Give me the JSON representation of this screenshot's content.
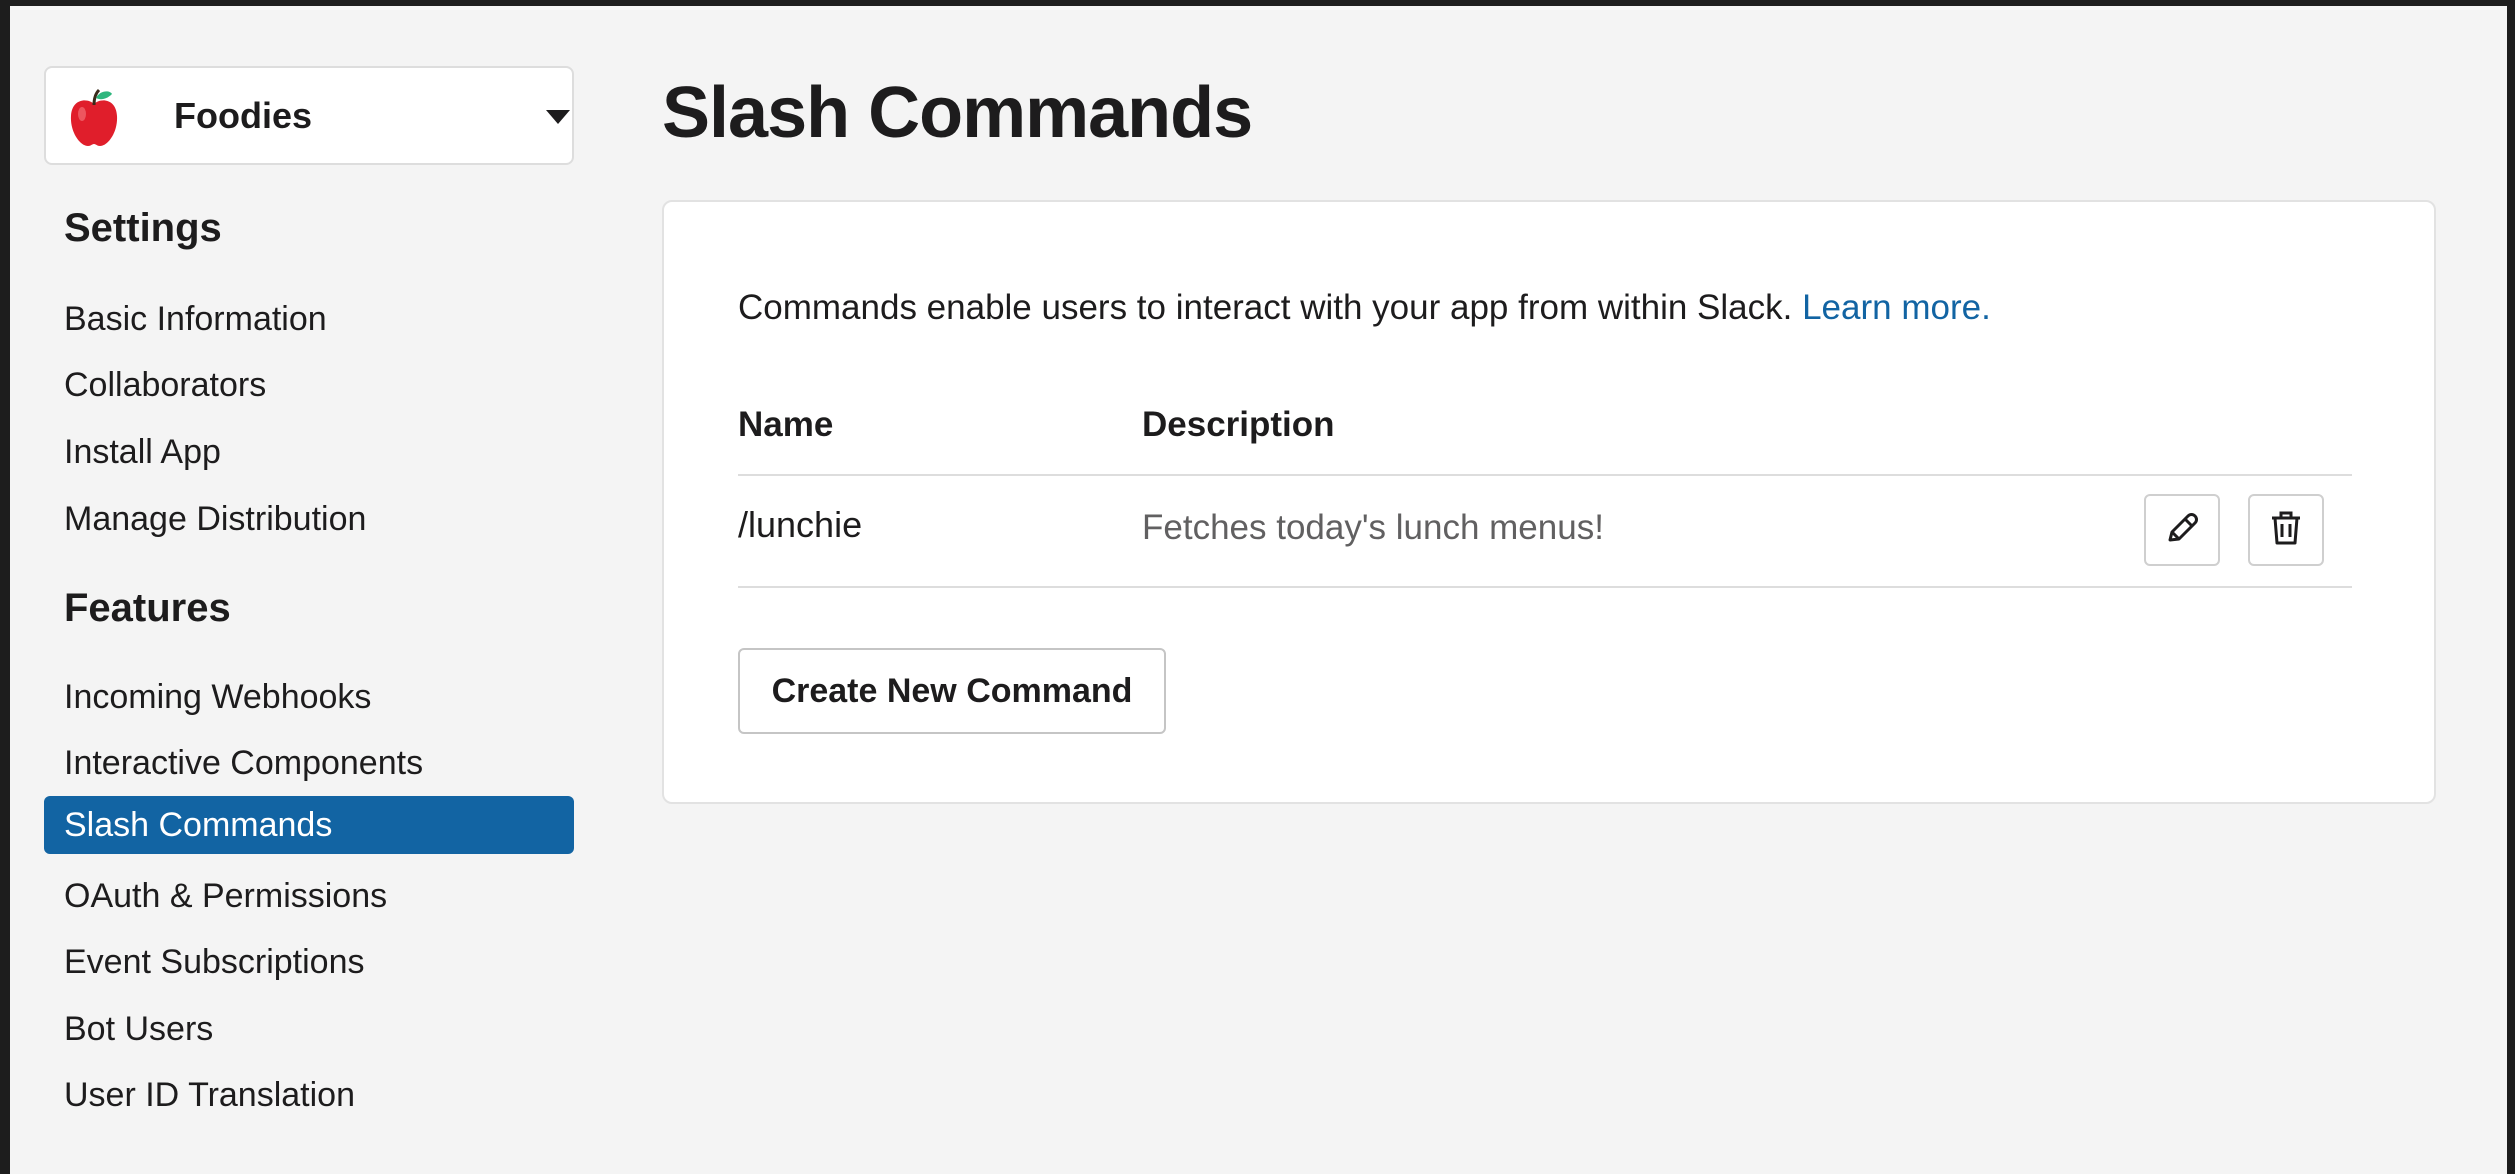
{
  "app": {
    "name": "Foodies",
    "icon": "apple-icon"
  },
  "sidebar": {
    "settings_heading": "Settings",
    "settings_items": [
      {
        "label": "Basic Information"
      },
      {
        "label": "Collaborators"
      },
      {
        "label": "Install App"
      },
      {
        "label": "Manage Distribution"
      }
    ],
    "features_heading": "Features",
    "features_items": [
      {
        "label": "Incoming Webhooks"
      },
      {
        "label": "Interactive Components"
      },
      {
        "label": "Slash Commands",
        "active": true
      },
      {
        "label": "OAuth & Permissions"
      },
      {
        "label": "Event Subscriptions"
      },
      {
        "label": "Bot Users"
      },
      {
        "label": "User ID Translation"
      }
    ]
  },
  "main": {
    "title": "Slash Commands",
    "intro_text": "Commands enable users to interact with your app from within Slack.",
    "learn_more": "Learn more.",
    "table": {
      "headers": {
        "name": "Name",
        "description": "Description"
      },
      "rows": [
        {
          "name": "/lunchie",
          "description": "Fetches today's lunch menus!"
        }
      ]
    },
    "create_button": "Create New Command"
  },
  "colors": {
    "accent": "#1264a3",
    "background": "#f4f4f4",
    "text": "#1d1c1d"
  }
}
